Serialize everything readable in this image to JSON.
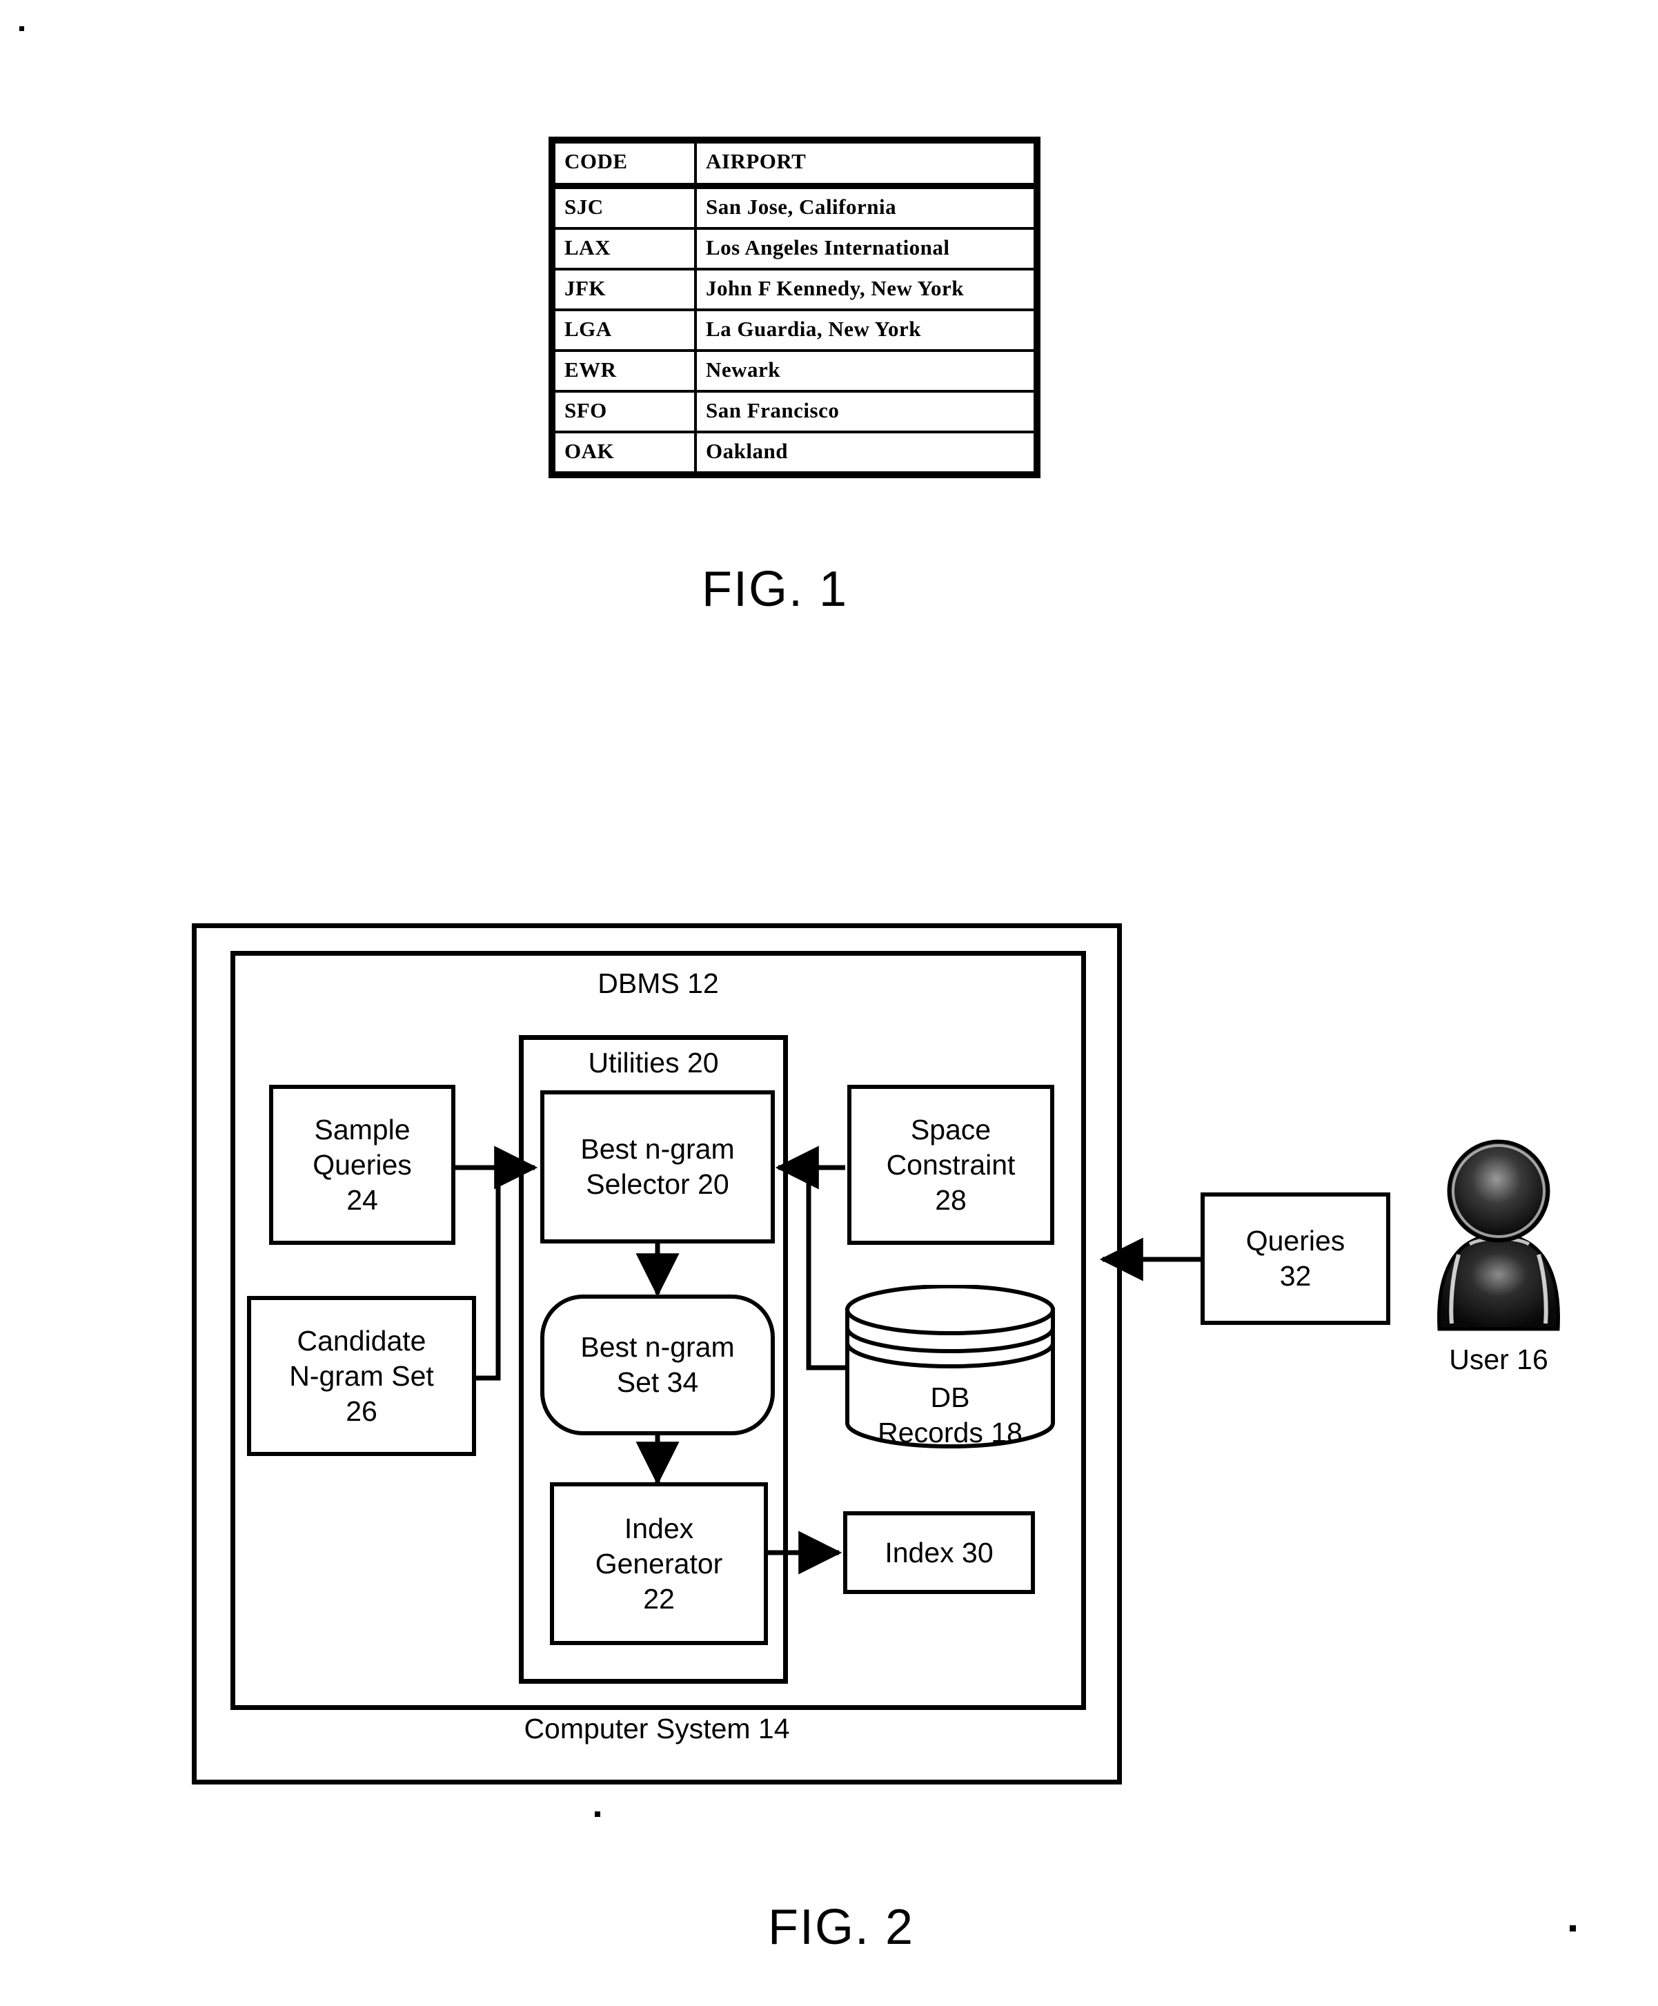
{
  "figure1": {
    "caption": "FIG. 1",
    "table": {
      "name": "airport-code-table",
      "headers": [
        "CODE",
        "AIRPORT"
      ],
      "rows": [
        [
          "SJC",
          "San Jose, California"
        ],
        [
          "LAX",
          "Los Angeles International"
        ],
        [
          "JFK",
          "John F Kennedy, New York"
        ],
        [
          "LGA",
          "La Guardia, New York"
        ],
        [
          "EWR",
          "Newark"
        ],
        [
          "SFO",
          "San Francisco"
        ],
        [
          "OAK",
          "Oakland"
        ]
      ]
    }
  },
  "figure2": {
    "caption": "FIG. 2",
    "outer_container_label": "Computer System 14",
    "dbms_label": "DBMS 12",
    "utilities_label": "Utilities 20",
    "blocks": {
      "sample_queries": "Sample\nQueries\n24",
      "candidate_ngram_set": "Candidate\nN-gram Set\n26",
      "best_ngram_selector": "Best n-gram\nSelector 20",
      "best_ngram_set": "Best n-gram\nSet 34",
      "index_generator": "Index\nGenerator\n22",
      "space_constraint": "Space\nConstraint\n28",
      "db_records": "DB\nRecords 18",
      "index": "Index 30",
      "queries": "Queries\n32",
      "user": "User 16"
    },
    "icons": {
      "user": "user-person-icon",
      "database": "database-cylinder-icon"
    },
    "colors": {
      "stroke": "#000000",
      "fill": "#ffffff"
    }
  }
}
